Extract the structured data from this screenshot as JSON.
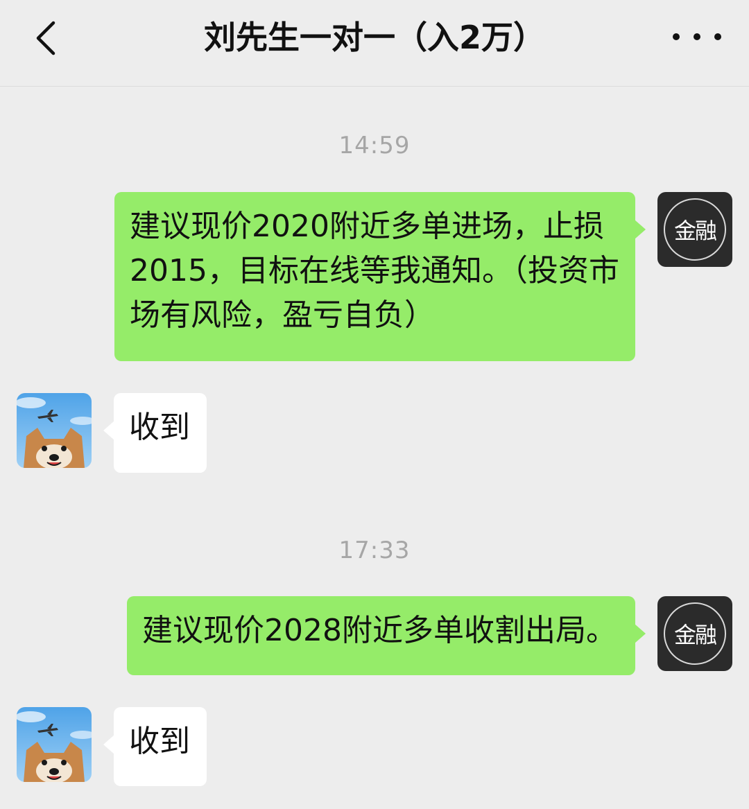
{
  "header": {
    "title": "刘先生一对一（入2万）"
  },
  "icons": {
    "back": "chevron-left-icon",
    "more": "more-dots-icon"
  },
  "brand_avatar": {
    "label": "金融"
  },
  "messages": [
    {
      "type": "timestamp",
      "text": "14:59"
    },
    {
      "type": "outgoing",
      "text": "建议现价2020附近多单进场，止损2015，目标在线等我通知。（投资市场有风险，盈亏自负）"
    },
    {
      "type": "incoming",
      "text": "收到"
    },
    {
      "type": "timestamp",
      "text": "17:33"
    },
    {
      "type": "outgoing",
      "text": "建议现价2028附近多单收割出局。"
    },
    {
      "type": "incoming",
      "text": "收到"
    }
  ],
  "colors": {
    "background": "#ededed",
    "outgoing_bubble": "#95ec69",
    "incoming_bubble": "#ffffff",
    "brand_avatar_bg": "#2b2b2b"
  }
}
